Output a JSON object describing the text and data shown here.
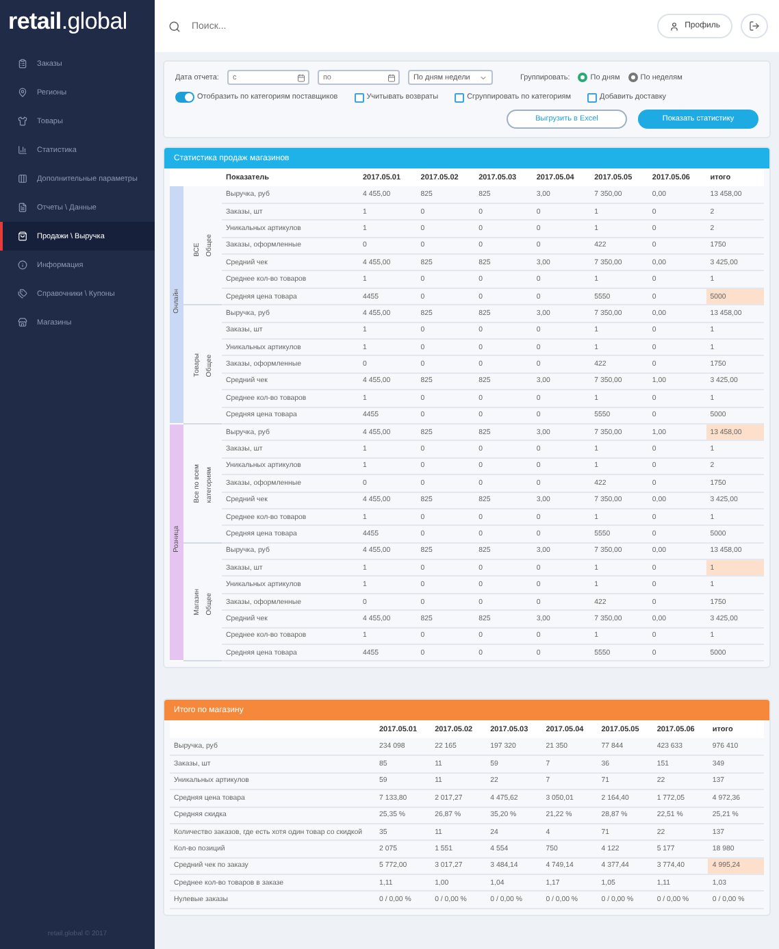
{
  "sidebar": {
    "logo": "**retail**.global",
    "items": [
      {
        "label": "Заказы",
        "selected": false
      },
      {
        "label": "Регионы",
        "selected": false
      },
      {
        "label": "Товары",
        "selected": false
      },
      {
        "label": "Статистика",
        "selected": false
      },
      {
        "label": "Дополнительные параметры",
        "selected": false
      },
      {
        "label": "Отчеты \\ Данные",
        "selected": false
      },
      {
        "label": "Продажи \\ Выручка",
        "selected": true
      },
      {
        "label": "Информация",
        "selected": false
      },
      {
        "label": "Справочники \\ Купоны",
        "selected": false
      },
      {
        "label": "Магазины",
        "selected": false
      }
    ],
    "footer": "retail.global © 2017"
  },
  "topbar": {
    "search_placeholder": "Поиск...",
    "profile": "Профиль"
  },
  "filters": {
    "date_label": "Дата отчета:",
    "date_from_placeholder": "с",
    "date_to_placeholder": "по",
    "period": "По дням недели",
    "group_label": "Группировать:",
    "group_options": [
      {
        "label": "По дням",
        "selected": true
      },
      {
        "label": "По неделям",
        "selected": false
      }
    ],
    "toggle": {
      "label": "Отобразить по категориям поставщиков",
      "on": true
    },
    "checkboxes": [
      {
        "label": "Учитывать возвраты",
        "checked": false
      },
      {
        "label": "Сгруппировать по категориям",
        "checked": false
      },
      {
        "label": "Добавить доставку",
        "checked": false
      }
    ],
    "export_button": "Выгрузить в Excel",
    "show_button": "Показать статистику"
  },
  "table1": {
    "title": "Статистика продаж магазинов",
    "columns": [
      "Показатель",
      "2017.05.01",
      "2017.05.02",
      "2017.05.03",
      "2017.05.04",
      "2017.05.05",
      "2017.05.06",
      "итого"
    ],
    "groups": [
      {
        "label": "Онлайн",
        "color": "#c9d9f5",
        "subgroups": [
          {
            "labels": [
              "ВСЕ",
              "Общее"
            ],
            "rows": [
              {
                "name": "Выручка, руб",
                "values": [
                  "4 455,00",
                  "825",
                  "825",
                  "3,00",
                  "7 350,00",
                  "0,00",
                  "13 458,00"
                ],
                "highlighted": false
              },
              {
                "name": "Заказы, шт",
                "values": [
                  "1",
                  "0",
                  "0",
                  "0",
                  "1",
                  "0",
                  "2"
                ],
                "highlighted": false
              },
              {
                "name": "Уникальных артикулов",
                "values": [
                  "1",
                  "0",
                  "0",
                  "0",
                  "1",
                  "0",
                  "2"
                ],
                "highlighted": false
              },
              {
                "name": "Заказы, оформленные",
                "values": [
                  "0",
                  "0",
                  "0",
                  "0",
                  "422",
                  "0",
                  "1750"
                ],
                "highlighted": false
              },
              {
                "name": "Средний чек",
                "values": [
                  "4 455,00",
                  "825",
                  "825",
                  "3,00",
                  "7 350,00",
                  "0,00",
                  "3 425,00"
                ],
                "highlighted": false
              },
              {
                "name": "Среднее кол-во товаров",
                "values": [
                  "1",
                  "0",
                  "0",
                  "0",
                  "1",
                  "0",
                  "1"
                ],
                "highlighted": false
              },
              {
                "name": "Средняя цена товара",
                "values": [
                  "4455",
                  "0",
                  "0",
                  "0",
                  "5550",
                  "0",
                  "5000"
                ],
                "highlighted": true
              }
            ]
          },
          {
            "labels": [
              "Товары",
              "Общее"
            ],
            "rows": [
              {
                "name": "Выручка, руб",
                "values": [
                  "4 455,00",
                  "825",
                  "825",
                  "3,00",
                  "7 350,00",
                  "0,00",
                  "13 458,00"
                ],
                "highlighted": false
              },
              {
                "name": "Заказы, шт",
                "values": [
                  "1",
                  "0",
                  "0",
                  "0",
                  "1",
                  "0",
                  "1"
                ],
                "highlighted": false
              },
              {
                "name": "Уникальных артикулов",
                "values": [
                  "1",
                  "0",
                  "0",
                  "0",
                  "1",
                  "0",
                  "1"
                ],
                "highlighted": false
              },
              {
                "name": "Заказы, оформленные",
                "values": [
                  "0",
                  "0",
                  "0",
                  "0",
                  "422",
                  "0",
                  "1750"
                ],
                "highlighted": false
              },
              {
                "name": "Средний чек",
                "values": [
                  "4 455,00",
                  "825",
                  "825",
                  "3,00",
                  "7 350,00",
                  "1,00",
                  "3 425,00"
                ],
                "highlighted": false
              },
              {
                "name": "Среднее кол-во товаров",
                "values": [
                  "1",
                  "0",
                  "0",
                  "0",
                  "1",
                  "0",
                  "1"
                ],
                "highlighted": false
              },
              {
                "name": "Средняя цена товара",
                "values": [
                  "4455",
                  "0",
                  "0",
                  "0",
                  "5550",
                  "0",
                  "5000"
                ],
                "highlighted": false
              }
            ]
          }
        ]
      },
      {
        "label": "Розница",
        "color": "#e6c4f2",
        "subgroups": [
          {
            "labels": [
              "Все по всем",
              "категориям"
            ],
            "rows": [
              {
                "name": "Выручка, руб",
                "values": [
                  "4 455,00",
                  "825",
                  "825",
                  "3,00",
                  "7 350,00",
                  "1,00",
                  "13 458,00"
                ],
                "highlighted": true
              },
              {
                "name": "Заказы, шт",
                "values": [
                  "1",
                  "0",
                  "0",
                  "0",
                  "1",
                  "0",
                  "1"
                ],
                "highlighted": false
              },
              {
                "name": "Уникальных артикулов",
                "values": [
                  "1",
                  "0",
                  "0",
                  "0",
                  "1",
                  "0",
                  "2"
                ],
                "highlighted": false
              },
              {
                "name": "Заказы, оформленные",
                "values": [
                  "0",
                  "0",
                  "0",
                  "0",
                  "422",
                  "0",
                  "1750"
                ],
                "highlighted": false
              },
              {
                "name": "Средний чек",
                "values": [
                  "4 455,00",
                  "825",
                  "825",
                  "3,00",
                  "7 350,00",
                  "0,00",
                  "3 425,00"
                ],
                "highlighted": false
              },
              {
                "name": "Среднее кол-во товаров",
                "values": [
                  "1",
                  "0",
                  "0",
                  "0",
                  "1",
                  "0",
                  "1"
                ],
                "highlighted": false
              },
              {
                "name": "Средняя цена товара",
                "values": [
                  "4455",
                  "0",
                  "0",
                  "0",
                  "5550",
                  "0",
                  "5000"
                ],
                "highlighted": false
              }
            ]
          },
          {
            "labels": [
              "Магазин",
              "Общее"
            ],
            "rows": [
              {
                "name": "Выручка, руб",
                "values": [
                  "4 455,00",
                  "825",
                  "825",
                  "3,00",
                  "7 350,00",
                  "0,00",
                  "13 458,00"
                ],
                "highlighted": false
              },
              {
                "name": "Заказы, шт",
                "values": [
                  "1",
                  "0",
                  "0",
                  "0",
                  "1",
                  "0",
                  "1"
                ],
                "highlighted": true
              },
              {
                "name": "Уникальных артикулов",
                "values": [
                  "1",
                  "0",
                  "0",
                  "0",
                  "1",
                  "0",
                  "1"
                ],
                "highlighted": false
              },
              {
                "name": "Заказы, оформленные",
                "values": [
                  "0",
                  "0",
                  "0",
                  "0",
                  "422",
                  "0",
                  "1750"
                ],
                "highlighted": false
              },
              {
                "name": "Средний чек",
                "values": [
                  "4 455,00",
                  "825",
                  "825",
                  "3,00",
                  "7 350,00",
                  "0,00",
                  "3 425,00"
                ],
                "highlighted": false
              },
              {
                "name": "Среднее кол-во товаров",
                "values": [
                  "1",
                  "0",
                  "0",
                  "0",
                  "1",
                  "0",
                  "1"
                ],
                "highlighted": false
              },
              {
                "name": "Средняя цена товара",
                "values": [
                  "4455",
                  "0",
                  "0",
                  "0",
                  "5550",
                  "0",
                  "5000"
                ],
                "highlighted": false
              }
            ]
          }
        ]
      }
    ]
  },
  "table2": {
    "title": "Итого по магазину",
    "columns": [
      "2017.05.01",
      "2017.05.02",
      "2017.05.03",
      "2017.05.04",
      "2017.05.05",
      "2017.05.06",
      "итого"
    ],
    "rows": [
      {
        "name": "Выручка, руб",
        "values": [
          "234 098",
          "22 165",
          "197 320",
          "21 350",
          "77 844",
          "423 633",
          "976 410"
        ],
        "highlighted": false
      },
      {
        "name": "Заказы, шт",
        "values": [
          "85",
          "11",
          "59",
          "7",
          "36",
          "151",
          "349"
        ],
        "highlighted": false
      },
      {
        "name": "Уникальных артикулов",
        "values": [
          "59",
          "11",
          "22",
          "7",
          "71",
          "22",
          "137"
        ],
        "highlighted": false
      },
      {
        "name": "Средняя цена товара",
        "values": [
          "7 133,80",
          "2 017,27",
          "4 475,62",
          "3 050,01",
          "2 164,40",
          "1 772,05",
          "4 972,36"
        ],
        "highlighted": false
      },
      {
        "name": "Средняя скидка",
        "values": [
          "25,35 %",
          "26,87 %",
          "35,20 %",
          "21,22 %",
          "28,87 %",
          "22,51 %",
          "25,21 %"
        ],
        "highlighted": false
      },
      {
        "name": "Количество заказов, где есть хотя один товар со скидкой",
        "values": [
          "35",
          "11",
          "24",
          "4",
          "71",
          "22",
          "137"
        ],
        "highlighted": false
      },
      {
        "name": "Кол-во позиций",
        "values": [
          "2 075",
          "1 551",
          "4 554",
          "750",
          "4 122",
          "5 177",
          "18 980"
        ],
        "highlighted": false
      },
      {
        "name": "Средний чек по заказу",
        "values": [
          "5 772,00",
          "3 017,27",
          "3 484,14",
          "4 749,14",
          "4 377,44",
          "3 774,40",
          "4 995,24"
        ],
        "highlighted": true
      },
      {
        "name": "Среднее кол-во товаров в заказе",
        "values": [
          "1,11",
          "1,00",
          "1,04",
          "1,17",
          "1,05",
          "1,11",
          "1,03"
        ],
        "highlighted": false
      },
      {
        "name": "Нулевые заказы",
        "values": [
          "0 / 0,00 %",
          "0 / 0,00 %",
          "0 / 0,00 %",
          "0 / 0,00 %",
          "0 / 0,00 %",
          "0 / 0,00 %",
          "0 / 0,00 %"
        ],
        "highlighted": false
      }
    ]
  }
}
